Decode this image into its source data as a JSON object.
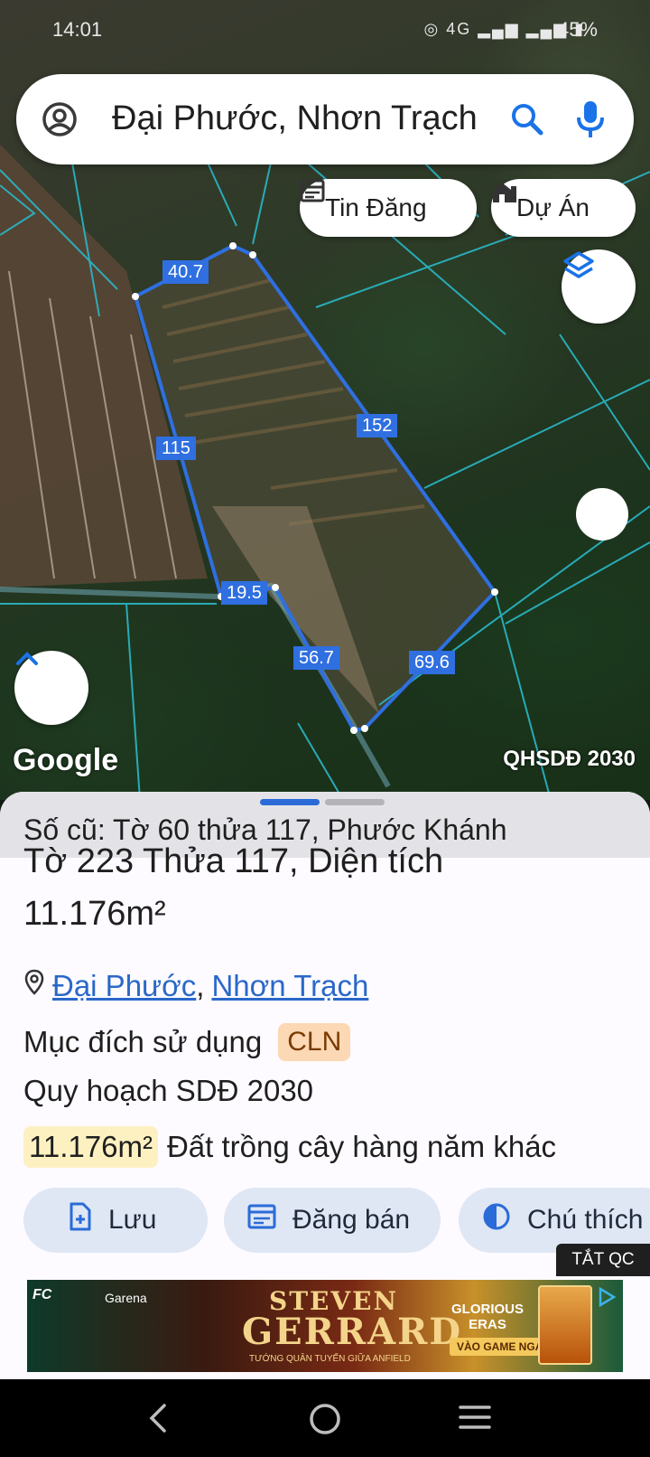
{
  "status_bar": {
    "time": "14:01",
    "network": "4G",
    "battery": "45%"
  },
  "search": {
    "query": "Đại Phước, Nhơn Trạch"
  },
  "chips": {
    "tin_dang": "Tin Đăng",
    "du_an": "Dự Án"
  },
  "map": {
    "provider": "Google",
    "plan_layer": "QHSDĐ 2030",
    "edge_lengths": [
      "40.7",
      "152",
      "115",
      "19.5",
      "56.7",
      "69.6"
    ]
  },
  "parcel": {
    "old_info": "Số cũ: Tờ 60 thửa 117, Phước Khánh",
    "title_line1": "Tờ 223 Thửa 117, Diện tích",
    "title_line2": "11.176m²",
    "location_ward": "Đại Phước",
    "location_separator": ",",
    "location_district": "Nhơn Trạch",
    "purpose_label": "Mục đích sử dụng",
    "purpose_code": "CLN",
    "plan_label": "Quy hoạch SDĐ 2030",
    "plan_area": "11.176m²",
    "plan_land_type": "Đất trồng cây hàng năm khác"
  },
  "actions": {
    "save": "Lưu",
    "post": "Đăng bán",
    "legend": "Chú thích"
  },
  "ad": {
    "close_label": "TẮT QC",
    "brand1": "FC",
    "brand2": "Garena",
    "headline_1": "STEVEN",
    "headline_2": "GERRARD",
    "tagline": "TƯỚNG QUÂN TUYẾN GIỮA ANFIELD",
    "era_1": "GLORIOUS",
    "era_2": "ERAS",
    "cta": "VÀO GAME NGAY"
  },
  "colors": {
    "accent": "#2f6fe0",
    "badge_cln": "#fcd8b4",
    "badge_area": "#fdf1c2",
    "tab_active": "#2a6bd8",
    "tab_inactive": "#b4b4b8"
  }
}
